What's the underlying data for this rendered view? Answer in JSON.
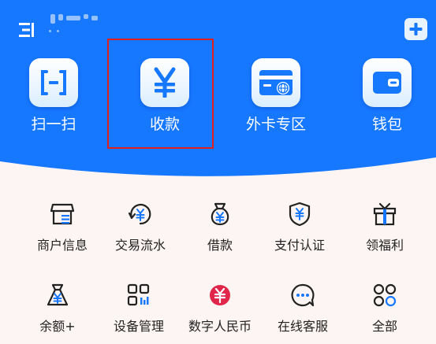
{
  "colors": {
    "brand_blue": "#1677ff",
    "page_bg": "#fdf5f3",
    "highlight_red": "#e0201e"
  },
  "quick_actions": [
    {
      "label": "扫一扫",
      "icon": "scan-icon"
    },
    {
      "label": "收款",
      "icon": "yuan-icon"
    },
    {
      "label": "外卡专区",
      "icon": "foreign-card-icon"
    },
    {
      "label": "钱包",
      "icon": "wallet-icon"
    }
  ],
  "services": [
    {
      "label": "商户信息",
      "icon": "merchant-icon"
    },
    {
      "label": "交易流水",
      "icon": "transaction-flow-icon"
    },
    {
      "label": "借款",
      "icon": "loan-bag-icon"
    },
    {
      "label": "支付认证",
      "icon": "shield-yuan-icon"
    },
    {
      "label": "领福利",
      "icon": "gift-icon"
    },
    {
      "label": "余额+",
      "icon": "money-bag-icon"
    },
    {
      "label": "设备管理",
      "icon": "device-grid-icon"
    },
    {
      "label": "数字人民币",
      "icon": "digital-rmb-icon"
    },
    {
      "label": "在线客服",
      "icon": "customer-service-icon"
    },
    {
      "label": "全部",
      "icon": "all-apps-icon"
    }
  ]
}
